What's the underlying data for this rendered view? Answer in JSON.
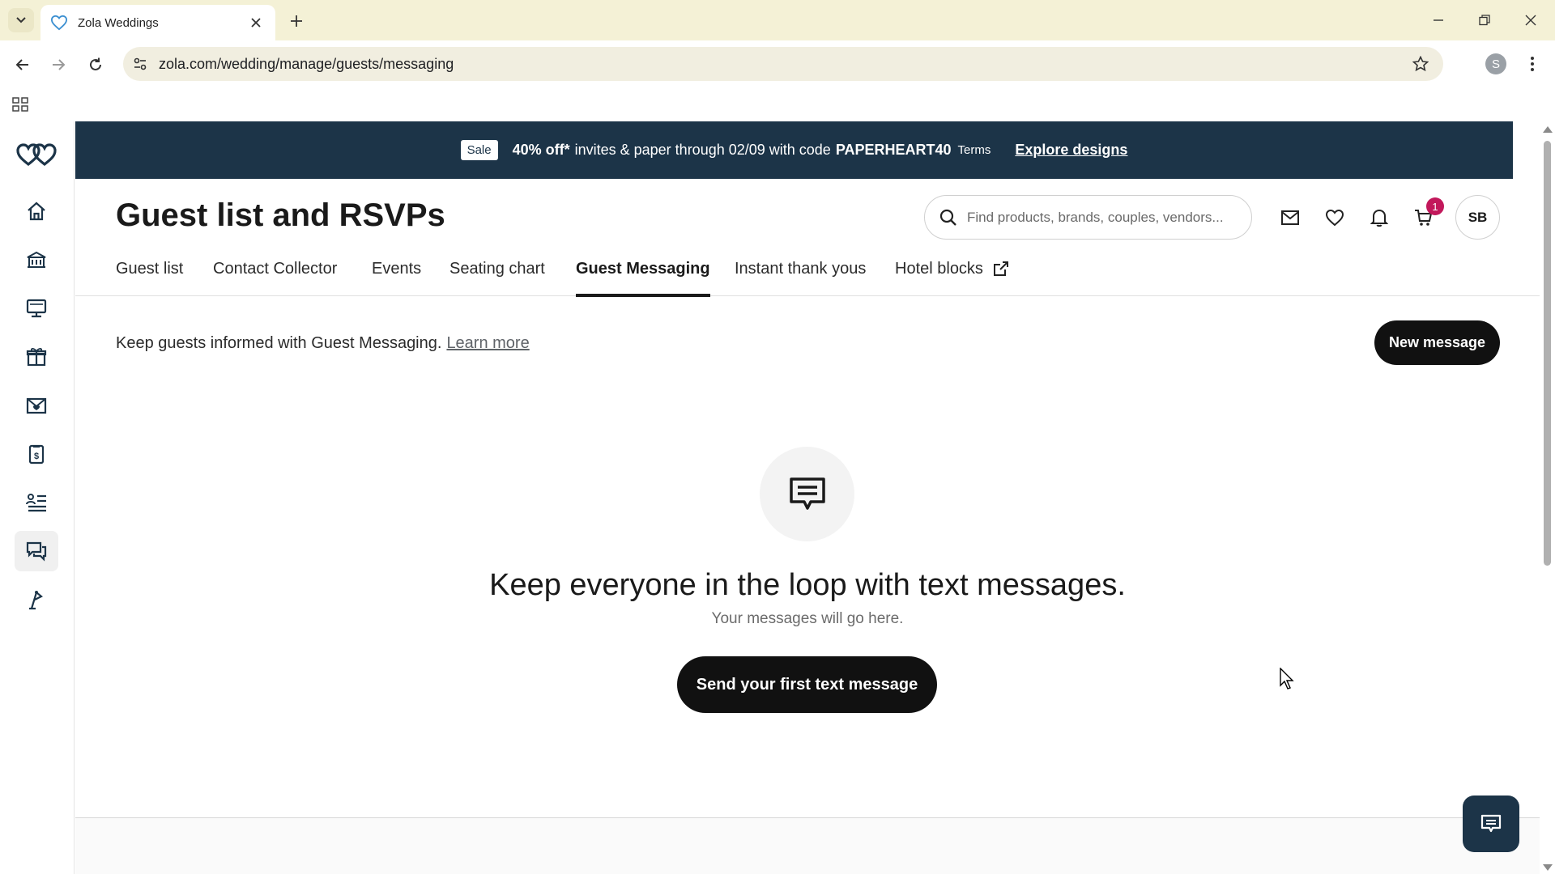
{
  "browser": {
    "tab_title": "Zola Weddings",
    "url": "zola.com/wedding/manage/guests/messaging",
    "profile_initial": "S"
  },
  "promo": {
    "tag": "Sale",
    "bold": "40% off*",
    "text": "invites & paper through 02/09 with code",
    "code": "PAPERHEART40",
    "terms": "Terms",
    "link": "Explore designs"
  },
  "header": {
    "title": "Guest list and RSVPs",
    "search_placeholder": "Find products, brands, couples, vendors...",
    "cart_count": "1",
    "avatar_initials": "SB"
  },
  "subnav": {
    "items": [
      {
        "label": "Guest list"
      },
      {
        "label": "Contact Collector"
      },
      {
        "label": "Events"
      },
      {
        "label": "Seating chart"
      },
      {
        "label": "Guest Messaging",
        "active": true
      },
      {
        "label": "Instant thank yous"
      },
      {
        "label": "Hotel blocks"
      }
    ]
  },
  "main": {
    "intro_text": "Keep guests informed with Guest Messaging.",
    "learn_more": "Learn more",
    "new_message_label": "New message",
    "empty_heading": "Keep everyone in the loop with text messages.",
    "empty_sub": "Your messages will go here.",
    "first_message_label": "Send your first text message"
  },
  "sidebar": {
    "items": [
      "home-icon",
      "venue-icon",
      "website-icon",
      "registry-icon",
      "invitations-icon",
      "budget-icon",
      "guest-list-icon",
      "guest-messaging-icon",
      "vendors-icon"
    ],
    "active": "guest-messaging-icon"
  },
  "colors": {
    "promo_bg": "#1c3448",
    "primary_button": "#111111",
    "cart_badge": "#c2185b",
    "chrome_bg": "#f4f1d6"
  }
}
